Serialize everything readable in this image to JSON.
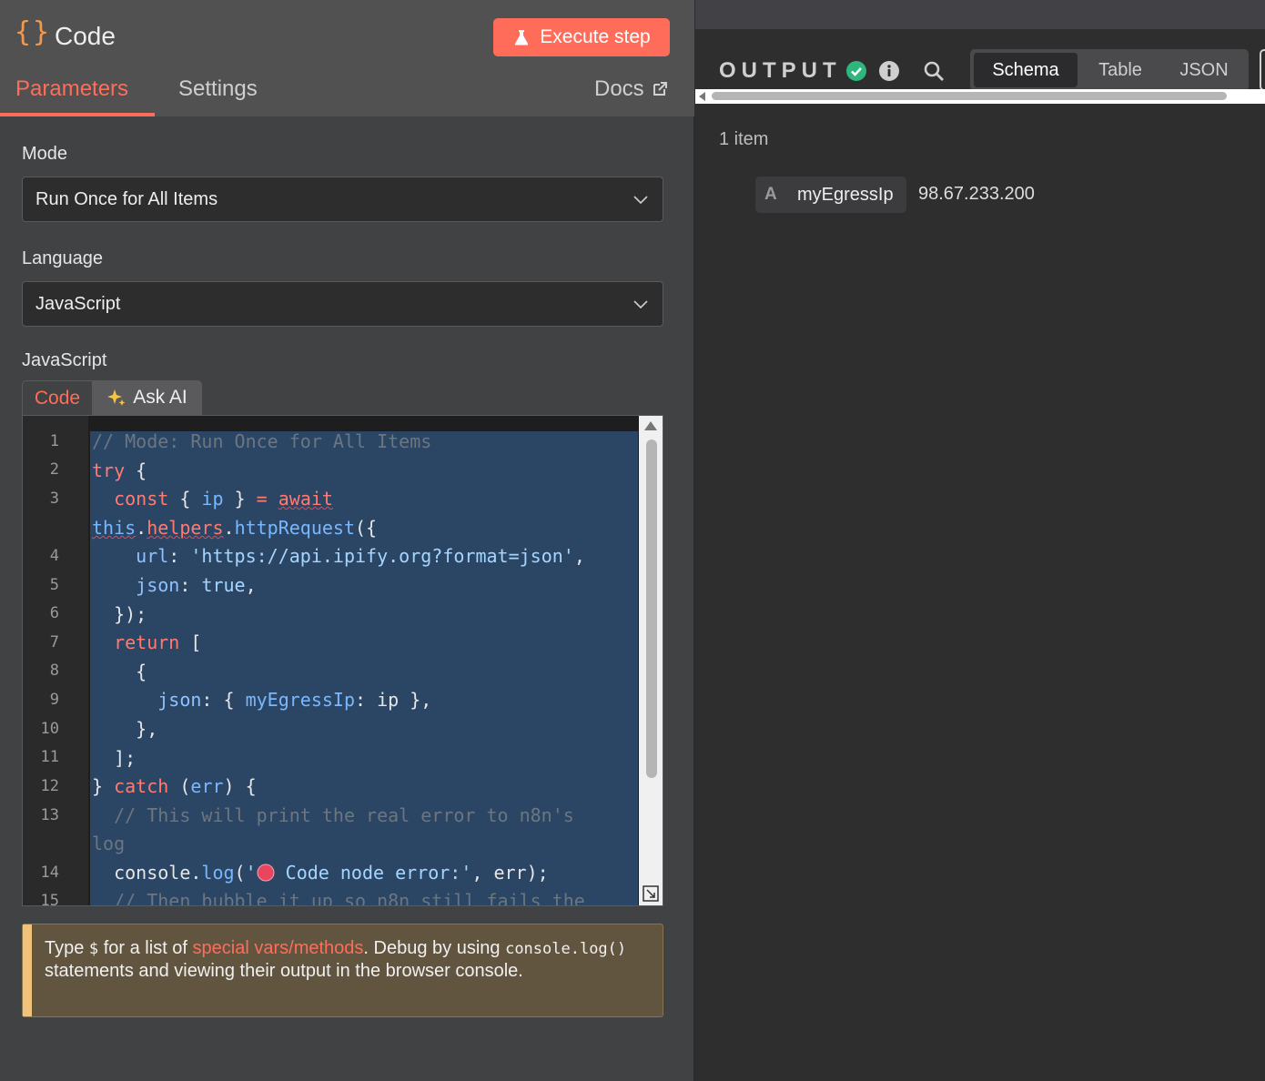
{
  "node": {
    "icon_text": "{}",
    "title": "Code",
    "execute_label": "Execute step"
  },
  "tabs": [
    {
      "label": "Parameters",
      "active": true
    },
    {
      "label": "Settings",
      "active": false
    }
  ],
  "docs_label": "Docs",
  "fields": {
    "mode": {
      "label": "Mode",
      "value": "Run Once for All Items"
    },
    "language": {
      "label": "Language",
      "value": "JavaScript"
    },
    "editor_label": "JavaScript"
  },
  "editor_tabs": [
    {
      "label": "Code",
      "active": true
    },
    {
      "label": "Ask AI",
      "active": false
    }
  ],
  "editor": {
    "line_numbers": [
      "1",
      "2",
      "3",
      "4",
      "5",
      "6",
      "7",
      "8",
      "9",
      "10",
      "11",
      "12",
      "13",
      "14",
      "15"
    ],
    "lines": [
      "// Mode: Run Once for All Items",
      "try {",
      "  const { ip } = await",
      "this.helpers.httpRequest({",
      "    url: 'https://api.ipify.org?format=json',",
      "    json: true,",
      "  });",
      "  return [",
      "    {",
      "      json: { myEgressIp: ip },",
      "    },",
      "  ];",
      "} catch (err) {",
      "  // This will print the real error to n8n's",
      "log",
      "  console.log('🔴 Code node error:', err);",
      "  // Then bubble it up so n8n still fails the"
    ]
  },
  "hint": {
    "p1": "Type ",
    "dollar": "$",
    "p2": " for a list of ",
    "link": "special vars/methods",
    "p3": ". Debug by using ",
    "code": "console.log()",
    "p4": " statements and viewing their output in the browser console."
  },
  "output": {
    "title": "OUTPUT",
    "views": [
      {
        "label": "Schema",
        "active": true
      },
      {
        "label": "Table",
        "active": false
      },
      {
        "label": "JSON",
        "active": false
      }
    ],
    "item_count": "1 item",
    "fields": [
      {
        "type": "A",
        "key": "myEgressIp",
        "value": "98.67.233.200"
      }
    ]
  },
  "colors": {
    "accent": "#ff6d5a",
    "success": "#2eb67d",
    "hint_bar": "#f0c27a"
  },
  "icons": [
    "braces-icon",
    "flask-icon",
    "external-link-icon",
    "chevron-down-icon",
    "sparkles-icon",
    "resize-icon",
    "check-circle-icon",
    "info-icon",
    "search-icon"
  ]
}
